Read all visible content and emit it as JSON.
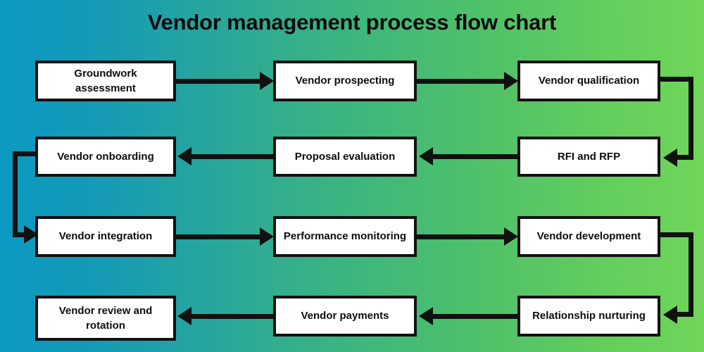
{
  "page": {
    "title": "Vendor management process flow chart",
    "background": {
      "gradient_from": "#0b9ac2",
      "gradient_to": "#6fd659",
      "direction": "left-to-right"
    },
    "box_fill": "#ffffff",
    "box_border": "#111111",
    "connector_color": "#111111"
  },
  "nodes": [
    {
      "id": "groundwork-assessment",
      "label": "Groundwork\nassessment",
      "row": 1,
      "col": "a"
    },
    {
      "id": "vendor-prospecting",
      "label": "Vendor prospecting",
      "row": 1,
      "col": "b"
    },
    {
      "id": "vendor-qualification",
      "label": "Vendor qualification",
      "row": 1,
      "col": "c"
    },
    {
      "id": "vendor-onboarding",
      "label": "Vendor onboarding",
      "row": 2,
      "col": "a"
    },
    {
      "id": "proposal-evaluation",
      "label": "Proposal evaluation",
      "row": 2,
      "col": "b"
    },
    {
      "id": "rfi-and-rfp",
      "label": "RFI and RFP",
      "row": 2,
      "col": "c"
    },
    {
      "id": "vendor-integration",
      "label": "Vendor integration",
      "row": 3,
      "col": "a"
    },
    {
      "id": "performance-monitoring",
      "label": "Performance monitoring",
      "row": 3,
      "col": "b"
    },
    {
      "id": "vendor-development",
      "label": "Vendor development",
      "row": 3,
      "col": "c"
    },
    {
      "id": "vendor-review-rotation",
      "label": "Vendor review and\nrotation",
      "row": 4,
      "col": "a"
    },
    {
      "id": "vendor-payments",
      "label": "Vendor payments",
      "row": 4,
      "col": "b"
    },
    {
      "id": "relationship-nurturing",
      "label": "Relationship nurturing",
      "row": 4,
      "col": "c"
    }
  ],
  "connectors": [
    {
      "from": "groundwork-assessment",
      "to": "vendor-prospecting",
      "kind": "straight-right"
    },
    {
      "from": "vendor-prospecting",
      "to": "vendor-qualification",
      "kind": "straight-right"
    },
    {
      "from": "vendor-qualification",
      "to": "rfi-and-rfp",
      "kind": "wrap-right-down"
    },
    {
      "from": "rfi-and-rfp",
      "to": "proposal-evaluation",
      "kind": "straight-left"
    },
    {
      "from": "proposal-evaluation",
      "to": "vendor-onboarding",
      "kind": "straight-left"
    },
    {
      "from": "vendor-onboarding",
      "to": "vendor-integration",
      "kind": "wrap-left-down"
    },
    {
      "from": "vendor-integration",
      "to": "performance-monitoring",
      "kind": "straight-right"
    },
    {
      "from": "performance-monitoring",
      "to": "vendor-development",
      "kind": "straight-right"
    },
    {
      "from": "vendor-development",
      "to": "relationship-nurturing",
      "kind": "wrap-right-down"
    },
    {
      "from": "relationship-nurturing",
      "to": "vendor-payments",
      "kind": "straight-left"
    },
    {
      "from": "vendor-payments",
      "to": "vendor-review-rotation",
      "kind": "straight-left"
    }
  ]
}
